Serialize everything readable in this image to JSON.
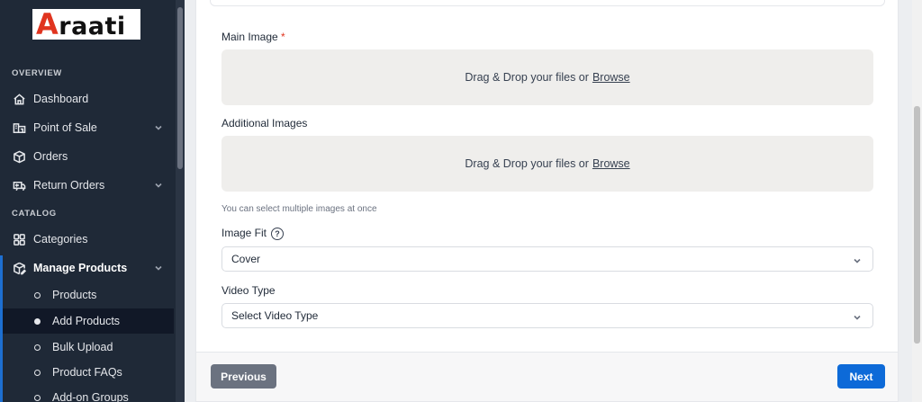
{
  "app": {
    "logo_accent": "A",
    "logo_rest": "raati",
    "accent_color": "#e0341f",
    "primary_color": "#0d6ad8"
  },
  "sidebar": {
    "sections": [
      {
        "label": "OVERVIEW"
      },
      {
        "label": "CATALOG"
      }
    ],
    "items": [
      {
        "label": "Dashboard",
        "icon": "home-icon"
      },
      {
        "label": "Point of Sale",
        "icon": "store-icon"
      },
      {
        "label": "Orders",
        "icon": "box-icon"
      },
      {
        "label": "Return Orders",
        "icon": "truck-return-icon"
      },
      {
        "label": "Categories",
        "icon": "grid-icon"
      },
      {
        "label": "Manage Products",
        "icon": "package-edit-icon"
      }
    ],
    "sub_items": [
      {
        "label": "Products"
      },
      {
        "label": "Add Products"
      },
      {
        "label": "Bulk Upload"
      },
      {
        "label": "Product FAQs"
      },
      {
        "label": "Add-on Groups"
      }
    ]
  },
  "form": {
    "main_image": {
      "label": "Main Image",
      "required_mark": "*",
      "drop_text": "Drag & Drop your files or",
      "browse_text": "Browse"
    },
    "additional_images": {
      "label": "Additional Images",
      "drop_text": "Drag & Drop your files or",
      "browse_text": "Browse",
      "helper": "You can select multiple images at once"
    },
    "image_fit": {
      "label": "Image Fit",
      "help_symbol": "?",
      "value": "Cover"
    },
    "video_type": {
      "label": "Video Type",
      "value": "Select Video Type"
    }
  },
  "footer": {
    "previous_label": "Previous",
    "next_label": "Next"
  }
}
